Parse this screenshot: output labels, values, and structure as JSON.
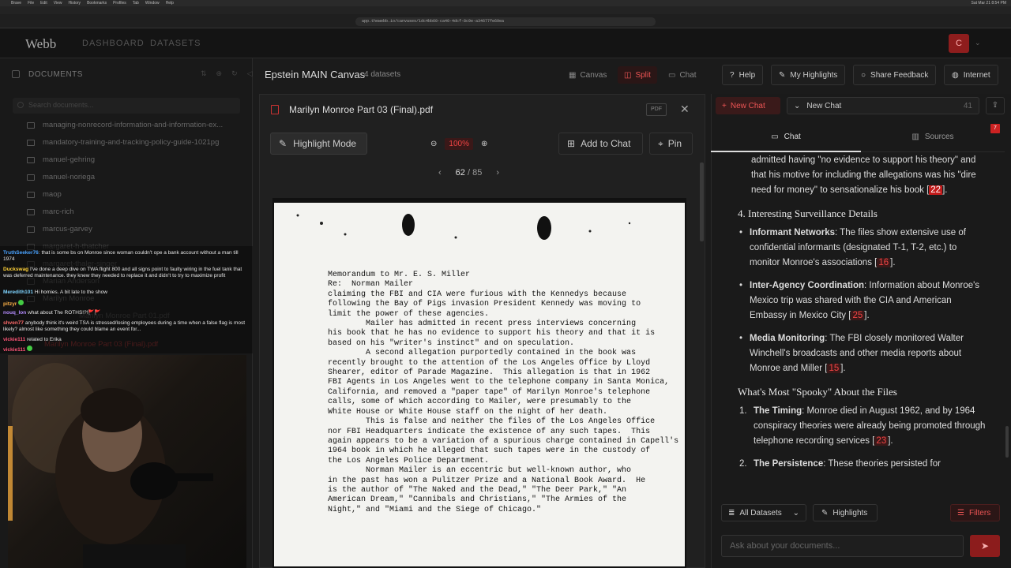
{
  "mac": {
    "menu": [
      "Brave",
      "File",
      "Edit",
      "View",
      "History",
      "Bookmarks",
      "Profiles",
      "Tab",
      "Window",
      "Help"
    ],
    "clock": "Sat Mar 21 8:54 PM"
  },
  "browser": {
    "url": "app.thewebb.io/canvases/1dc4bb60-ca40-4dcf-8c9e-a34677fe69ea"
  },
  "app": {
    "logo": "Webb",
    "nav": [
      "DASHBOARD",
      "DATASETS"
    ],
    "avatar": "C"
  },
  "sidebar": {
    "title": "DOCUMENTS",
    "search_placeholder": "Search documents...",
    "files": [
      "managing-nonrecord-information-and-information-ex...",
      "mandatory-training-and-tracking-policy-guide-1021pg",
      "manuel-gehring",
      "manuel-noriega",
      "maop",
      "marc-rich",
      "marcus-garvey",
      "margaret-h-thatcher",
      "margaret-thaler-singer",
      "Marian Anderson",
      "Marilyn Monroe",
      "Marilyn Monroe Part 01.pdf",
      "Marilyn Monroe Part 03 (Final).pdf"
    ]
  },
  "stream_chat": [
    {
      "user": "TruthSeeker76",
      "color": "#4aa3ff",
      "text": "that is some bs on Monroe since woman couldn't ope a bank account without a man till 1974"
    },
    {
      "user": "Duckswag",
      "color": "#ffd23a",
      "text": "I've done a deep dive on TWA flight 800 and all signs point to faulty wiring in the fuel tank that was deferred maintenance. they knew they needed to replace it and didn't to try to maximize profit"
    },
    {
      "user": "Meredith101",
      "color": "#7fd4ff",
      "text": "Hi homies. A bit late to the show"
    },
    {
      "user": "pitzyr",
      "color": "#ffb347",
      "text": ""
    },
    {
      "user": "nouq_lon",
      "color": "#b58cff",
      "text": "what about The ROTHS!?!🚩🚩"
    },
    {
      "user": "shven77",
      "color": "#ff6b6b",
      "text": "anybody think it's weird TSA is stressed/losing employees during a time when a false flag is most likely? almost like something they could blame an event for..."
    },
    {
      "user": "vickie111",
      "color": "#ff5577",
      "text": "related to Erika"
    },
    {
      "user": "vickie111",
      "color": "#ff5577",
      "text": ""
    }
  ],
  "workspace": {
    "title": "Epstein MAIN Canvas",
    "subtitle": "4 datasets",
    "views": [
      "Canvas",
      "Split",
      "Chat"
    ],
    "actions": [
      "Help",
      "My Highlights",
      "Share Feedback",
      "Internet"
    ]
  },
  "pdf": {
    "title": "Marilyn Monroe Part 03 (Final).pdf",
    "badge": "PDF",
    "highlight_mode": "Highlight Mode",
    "zoom": "100%",
    "add_to_chat": "Add to Chat",
    "pin": "Pin",
    "page": "62",
    "total": "/ 85",
    "memo_lines": [
      "Memorandum to Mr. E. S. Miller",
      "Re:  Norman Mailer",
      "",
      "claiming the FBI and CIA were furious with the Kennedys because",
      "following the Bay of Pigs invasion President Kennedy was moving to",
      "limit the power of these agencies.",
      "",
      "        Mailer has admitted in recent press interviews concerning",
      "his book that he has no evidence to support his theory and that it is",
      "based on his \"writer's instinct\" and on speculation.",
      "",
      "        A second allegation purportedly contained in the book was",
      "recently brought to the attention of the Los Angeles Office by Lloyd",
      "Shearer, editor of Parade Magazine.  This allegation is that in 1962",
      "FBI Agents in Los Angeles went to the telephone company in Santa Monica,",
      "California, and removed a \"paper tape\" of Marilyn Monroe's telephone",
      "calls, some of which according to Mailer, were presumably to the",
      "White House or White House staff on the night of her death.",
      "",
      "        This is false and neither the files of the Los Angeles Office",
      "nor FBI Headquarters indicate the existence of any such tapes.  This",
      "again appears to be a variation of a spurious charge contained in Capell's",
      "1964 book in which he alleged that such tapes were in the custody of",
      "the Los Angeles Police Department.",
      "",
      "        Norman Mailer is an eccentric but well-known author, who",
      "in the past has won a Pulitzer Prize and a National Book Award.  He",
      "is the author of \"The Naked and the Dead,\" \"The Deer Park,\" \"An",
      "American Dream,\" \"Cannibals and Christians,\" \"The Armies of the",
      "Night,\" and \"Miami and the Siege of Chicago.\""
    ]
  },
  "chat": {
    "new_chat_button": "New Chat",
    "selector": "New Chat",
    "selector_count": "41",
    "tabs": [
      "Chat",
      "Sources"
    ],
    "sources_badge": "7",
    "intro": [
      "admitted having \"no evidence to support his theory\" and that his motive for including the allegations was his \"dire need for money\" to sensationalize his book [",
      "22",
      "]."
    ],
    "section4": "4. Interesting Surveillance Details",
    "bullets": [
      {
        "term": "Informant Networks",
        "text": ": The files show extensive use of confidential informants (designated T-1, T-2, etc.) to monitor Monroe's associations [",
        "ref": "16",
        "end": "]."
      },
      {
        "term": "Inter-Agency Coordination",
        "text": ": Information about Monroe's Mexico trip was shared with the CIA and American Embassy in Mexico City [",
        "ref": "25",
        "end": "]."
      },
      {
        "term": "Media Monitoring",
        "text": ": The FBI closely monitored Walter Winchell's broadcasts and other media reports about Monroe and Miller [",
        "ref": "15",
        "end": "]."
      }
    ],
    "spooky": "What's Most \"Spooky\" About the Files",
    "numbered": [
      {
        "n": "1.",
        "term": "The Timing",
        "text": ": Monroe died in August 1962, and by 1964 conspiracy theories were already being promoted through telephone recording services [",
        "ref": "23",
        "end": "]."
      },
      {
        "n": "2.",
        "term": "The Persistence",
        "text": ": These theories persisted for",
        "ref": "",
        "end": ""
      }
    ],
    "all_datasets": "All Datasets",
    "highlights": "Highlights",
    "filters": "Filters",
    "ask_placeholder": "Ask about your documents..."
  }
}
